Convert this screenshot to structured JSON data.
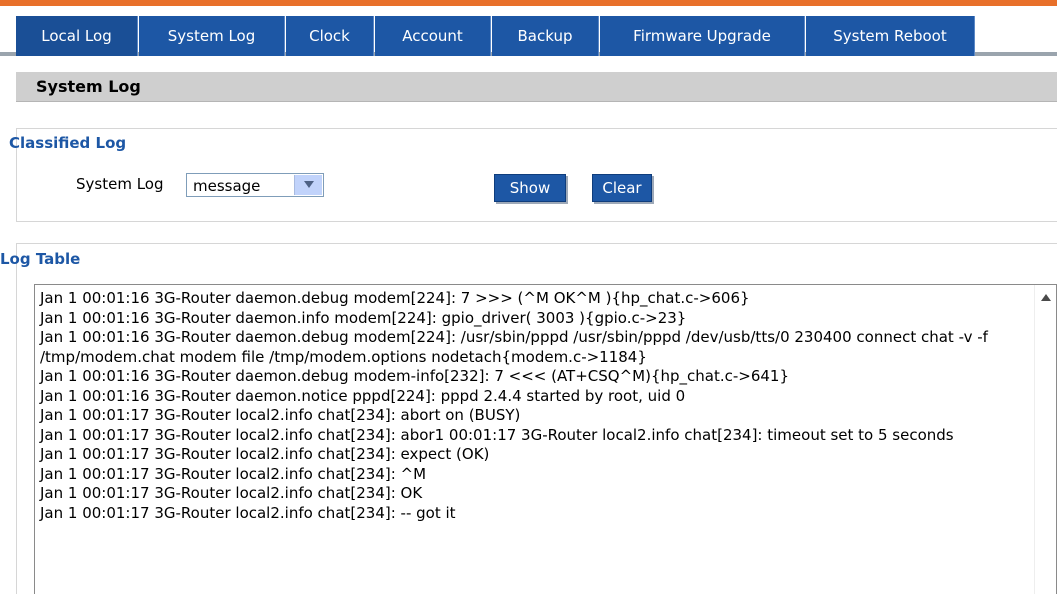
{
  "tabs": [
    {
      "label": "Local Log"
    },
    {
      "label": "System Log"
    },
    {
      "label": "Clock"
    },
    {
      "label": "Account"
    },
    {
      "label": "Backup"
    },
    {
      "label": "Firmware Upgrade"
    },
    {
      "label": "System Reboot"
    }
  ],
  "colors": {
    "accent_orange": "#e8702a",
    "tab_blue": "#1d57a5",
    "section_gray": "#cfcfcf"
  },
  "section": {
    "title": "System Log"
  },
  "classified": {
    "title": "Classified Log",
    "field_label": "System Log",
    "select_value": "message",
    "show_label": "Show",
    "clear_label": "Clear"
  },
  "log_table": {
    "title": "Log Table",
    "lines": [
      "Jan  1 00:01:16 3G-Router daemon.debug modem[224]: 7 >>> (^M OK^M ){hp_chat.c->606}",
      "Jan  1 00:01:16 3G-Router daemon.info modem[224]: gpio_driver( 3003 ){gpio.c->23}",
      "Jan  1 00:01:16 3G-Router daemon.debug modem[224]: /usr/sbin/pppd /usr/sbin/pppd /dev/usb/tts/0 230400 connect chat -v -f /tmp/modem.chat modem file /tmp/modem.options nodetach{modem.c->1184}",
      "Jan  1 00:01:16 3G-Router daemon.debug modem-info[232]: 7 <<< (AT+CSQ^M){hp_chat.c->641}",
      "Jan  1 00:01:16 3G-Router daemon.notice pppd[224]: pppd 2.4.4 started by root, uid 0",
      "Jan  1 00:01:17 3G-Router local2.info chat[234]: abort on (BUSY)",
      "Jan  1 00:01:17 3G-Router local2.info chat[234]: abor1 00:01:17 3G-Router local2.info chat[234]: timeout set to 5 seconds",
      "Jan  1 00:01:17 3G-Router local2.info chat[234]: expect (OK)",
      "Jan  1 00:01:17 3G-Router local2.info chat[234]: ^M",
      "Jan  1 00:01:17 3G-Router local2.info chat[234]: OK",
      "Jan  1 00:01:17 3G-Router local2.info chat[234]:  -- got it"
    ]
  }
}
